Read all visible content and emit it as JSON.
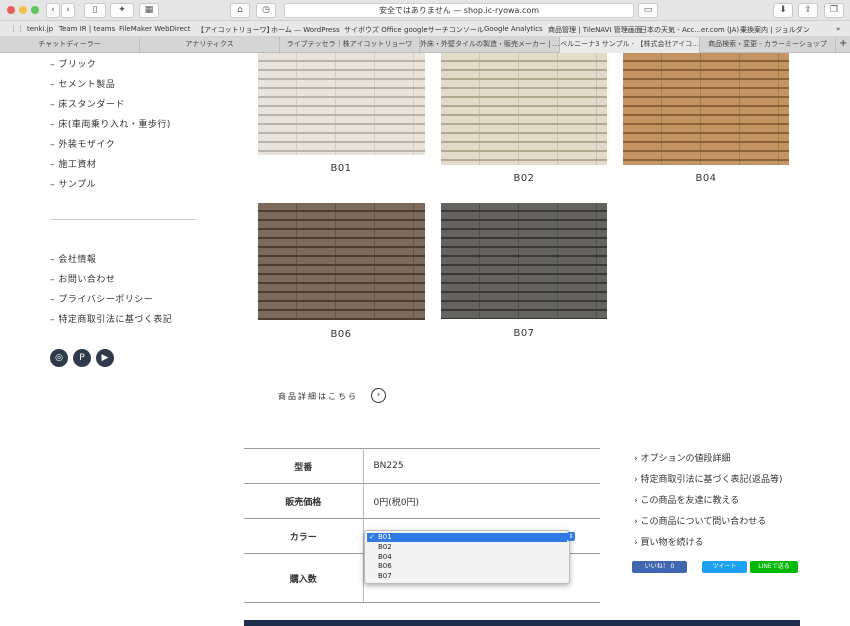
{
  "browser": {
    "address": "安全ではありません — shop.ic-ryowa.com",
    "bookmarks": [
      "tenki.jp",
      "Team IR | teams",
      "FileMaker WebDirect",
      "【アイコットリョーワ】",
      "ホーム — WordPress",
      "サイボウズ Office",
      "googleサーチコンソール",
      "Google Analytics",
      "商品管理 | TileNAVI 管理画面",
      "日本の天気 - Acc...er.com (JA)",
      "乗換案内 | ジョルダン"
    ],
    "tabs": [
      "チャットディーラー",
      "アナリティクス",
      "ライブテッセラ｜株アイコットリョーワ",
      "外床・外壁タイルの製造・販売メーカー | ...",
      "ベルニーナ3 サンプル - 【株式会社アイコ...",
      "商品検索・変更 - カラーミーショップ"
    ]
  },
  "sidebar": {
    "categories": [
      "ブリック",
      "セメント製品",
      "床スタンダード",
      "床(車両乗り入れ・重歩行)",
      "外装モザイク",
      "施工資材",
      "サンプル"
    ],
    "info": [
      "会社情報",
      "お問い合わせ",
      "プライバシーポリシー",
      "特定商取引法に基づく表記"
    ]
  },
  "colors": {
    "navy": "#1f2d4c",
    "facebook": "#4267b2",
    "twitter": "#1da1f2",
    "line": "#00b900",
    "select": "#2f7ae5"
  },
  "tiles": [
    {
      "code": "B01",
      "base": "#e8e4db",
      "dark": "#b9b3a8"
    },
    {
      "code": "B02",
      "base": "#e4dccb",
      "dark": "#b3a991"
    },
    {
      "code": "B04",
      "base": "#c49563",
      "dark": "#8b6239"
    },
    {
      "code": "B06",
      "base": "#7c6b5c",
      "dark": "#4a3d33"
    },
    {
      "code": "B07",
      "base": "#646360",
      "dark": "#393835"
    }
  ],
  "detail_link": "商品詳細はこちら",
  "spec": {
    "model_label": "型番",
    "model_value": "BN225",
    "price_label": "販売価格",
    "price_value": "0円(税0円)",
    "color_label": "カラー",
    "qty_label": "購入数"
  },
  "color_options": [
    "B01",
    "B02",
    "B04",
    "B06",
    "B07"
  ],
  "color_selected": "B01",
  "right_links": [
    "オプションの値段詳細",
    "特定商取引法に基づく表記(返品等)",
    "この商品を友達に教える",
    "この商品について問い合わせる",
    "買い物を続ける"
  ],
  "share": {
    "like": "いいね！ 0",
    "tweet": "ツイート",
    "line": "LINEで送る"
  }
}
